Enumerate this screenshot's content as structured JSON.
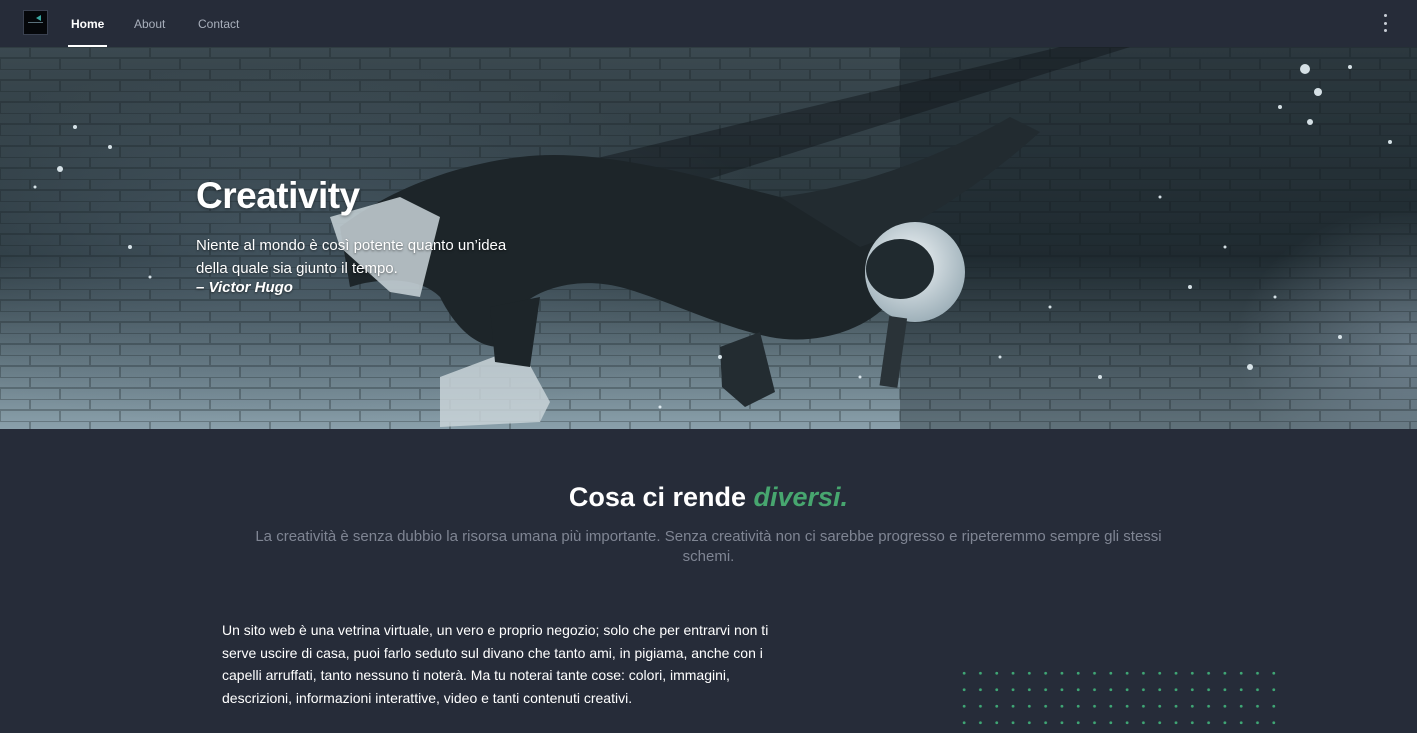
{
  "navbar": {
    "logo": "site-logo",
    "items": [
      {
        "label": "Home",
        "active": true
      },
      {
        "label": "About",
        "active": false
      },
      {
        "label": "Contact",
        "active": false
      }
    ],
    "menu_icon": "kebab-menu-icon"
  },
  "hero": {
    "title": "Creativity",
    "quote": "Niente al mondo è così potente quanto un’idea della quale sia giunto il tempo.",
    "author": "– Victor Hugo"
  },
  "section": {
    "title_prefix": "Cosa ci rende ",
    "title_accent": "diversi.",
    "subtitle": "La creatività è senza dubbio la risorsa umana più importante. Senza creatività non ci sarebbe progresso e ripeteremmo sempre gli stessi schemi.",
    "body": "Un sito web è una vetrina virtuale, un vero e proprio negozio; solo che per entrarvi non ti serve uscire di casa, puoi farlo seduto sul divano che tanto ami, in pigiama, anche con i capelli arruffati, tanto nessuno ti noterà. Ma tu noterai tante cose: colori, immagini, descrizioni, informazioni interattive, video e tanti contenuti creativi."
  },
  "colors": {
    "background": "#262c39",
    "accent": "#47a66f",
    "muted_text": "#7f8593"
  }
}
